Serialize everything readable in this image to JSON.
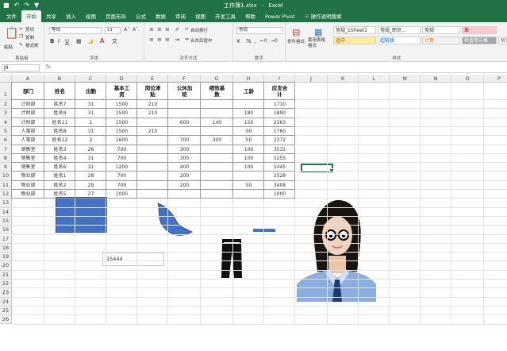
{
  "titlebar": {
    "filename": "工作簿1.xlsx",
    "separator": "-",
    "app": "Excel"
  },
  "tabs": [
    {
      "label": "文件",
      "active": false
    },
    {
      "label": "开始",
      "active": true
    },
    {
      "label": "共享",
      "active": false
    },
    {
      "label": "插入",
      "active": false
    },
    {
      "label": "绘图",
      "active": false
    },
    {
      "label": "页面布局",
      "active": false
    },
    {
      "label": "公式",
      "active": false
    },
    {
      "label": "数据",
      "active": false
    },
    {
      "label": "审阅",
      "active": false
    },
    {
      "label": "视图",
      "active": false
    },
    {
      "label": "开发工具",
      "active": false
    },
    {
      "label": "帮助",
      "active": false
    },
    {
      "label": "Power Pivot",
      "active": false
    },
    {
      "label": "操作说明搜索",
      "active": false
    }
  ],
  "ribbon": {
    "clipboard": {
      "paste": "粘贴",
      "cut": "剪切",
      "copy": "复制",
      "painter": "格式刷",
      "label": "剪贴板"
    },
    "font": {
      "name": "等线",
      "size": "11",
      "label": "字体",
      "bold": "B",
      "italic": "I",
      "underline": "U"
    },
    "alignment": {
      "wrap": "自动换行",
      "merge": "合并后居中",
      "label": "对齐方式"
    },
    "number": {
      "format": "常规",
      "percent": "%",
      "comma": ",",
      "label": "数字"
    },
    "styles": {
      "conditional": "条件格式",
      "table": "套用表格格式",
      "label": "样式",
      "cells": [
        {
          "text": "常规_1Sheet1",
          "bg": "#ffffff",
          "color": "#333333"
        },
        {
          "text": "常规_职员...",
          "bg": "#ffffff",
          "color": "#333333"
        },
        {
          "text": "常规",
          "bg": "#ffffff",
          "color": "#333333"
        },
        {
          "text": "差",
          "bg": "#ffc7ce",
          "color": "#9c0006"
        },
        {
          "text": "适中",
          "bg": "#ffeb9c",
          "color": "#9c5700"
        },
        {
          "text": "超链接",
          "bg": "#ffffff",
          "color": "#0563c1"
        },
        {
          "text": "计算",
          "bg": "#f2f2f2",
          "color": "#fa7d00"
        },
        {
          "text": "检查单元格",
          "bg": "#a5a5a5",
          "color": "#ffffff"
        },
        {
          "text": "解释",
          "bg": "#ffffff",
          "color": "#7f7f7f"
        }
      ]
    }
  },
  "formula_bar": {
    "name_box": "J9",
    "fx": "fx",
    "value": ""
  },
  "columns": [
    "A",
    "B",
    "C",
    "D",
    "E",
    "F",
    "G",
    "H",
    "I",
    "J",
    "K",
    "L",
    "M",
    "N",
    "O",
    "P"
  ],
  "rows": [
    "1",
    "2",
    "3",
    "4",
    "5",
    "6",
    "7",
    "8",
    "9",
    "10",
    "11",
    "12",
    "13",
    "14",
    "15",
    "16",
    "17",
    "18",
    "19",
    "20",
    "21",
    "22",
    "23",
    "24",
    "25",
    "26"
  ],
  "table": {
    "headers": [
      "部门",
      "姓名",
      "出勤",
      "基本工资",
      "岗位津贴",
      "公休加班",
      "绩效基数",
      "工龄",
      "应发合计"
    ],
    "rows": [
      [
        "计财部",
        "姓名7",
        "31",
        "1500",
        "210",
        "",
        "",
        "",
        "1710"
      ],
      [
        "计财部",
        "姓名9",
        "31",
        "1500",
        "210",
        "",
        "",
        "180",
        "1890"
      ],
      [
        "计财部",
        "姓名11",
        "1",
        "1500",
        "",
        "600",
        "140",
        "150",
        "2363"
      ],
      [
        "人事部",
        "姓名8",
        "31",
        "1500",
        "210",
        "",
        "",
        "50",
        "1760"
      ],
      [
        "人事部",
        "姓名12",
        "2",
        "1600",
        "",
        "700",
        "300",
        "50",
        "2372"
      ],
      [
        "销售室",
        "姓名3",
        "26",
        "700",
        "",
        "300",
        "",
        "100",
        "3531"
      ],
      [
        "销售室",
        "姓名4",
        "31",
        "700",
        "",
        "300",
        "",
        "100",
        "5255"
      ],
      [
        "销售室",
        "姓名6",
        "31",
        "1200",
        "",
        "400",
        "",
        "100",
        "5445"
      ],
      [
        "物业部",
        "姓名1",
        "28",
        "700",
        "",
        "200",
        "",
        "",
        "2528"
      ],
      [
        "物业部",
        "姓名2",
        "29",
        "700",
        "",
        "200",
        "",
        "50",
        "3408"
      ],
      [
        "物业部",
        "姓名5",
        "27",
        "1000",
        "",
        "",
        "",
        "",
        "1000"
      ]
    ]
  },
  "textbox": {
    "value": "15444"
  },
  "colors": {
    "excel_green": "#217346",
    "shape_blue": "#4472c4"
  }
}
